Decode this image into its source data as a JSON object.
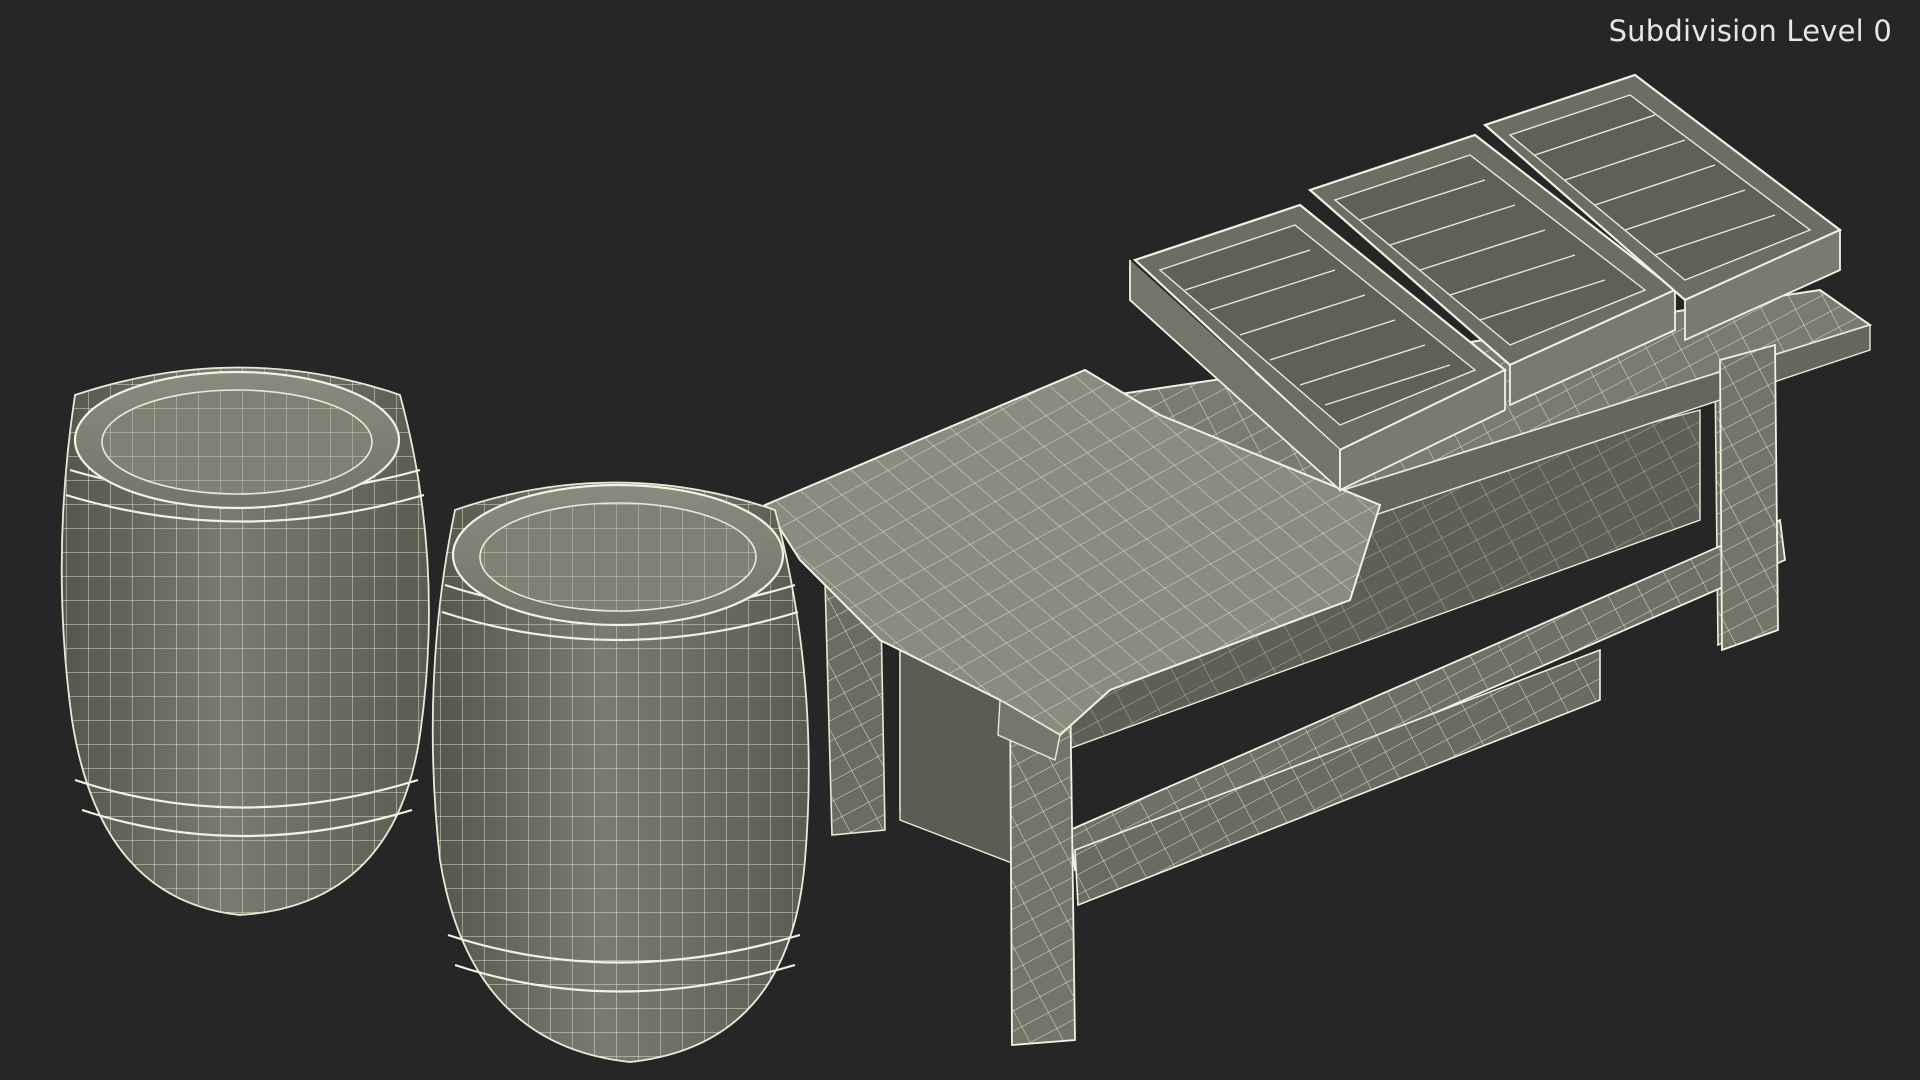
{
  "viewport": {
    "label": "Subdivision Level 0",
    "background_color": "#262626",
    "mesh_color": "#6d6e63",
    "wire_color": "#e9ead6"
  },
  "scene": {
    "objects": [
      "wooden barrel",
      "wooden barrel",
      "market table with tablecloth",
      "wooden crate",
      "wooden crate",
      "wooden crate"
    ]
  }
}
